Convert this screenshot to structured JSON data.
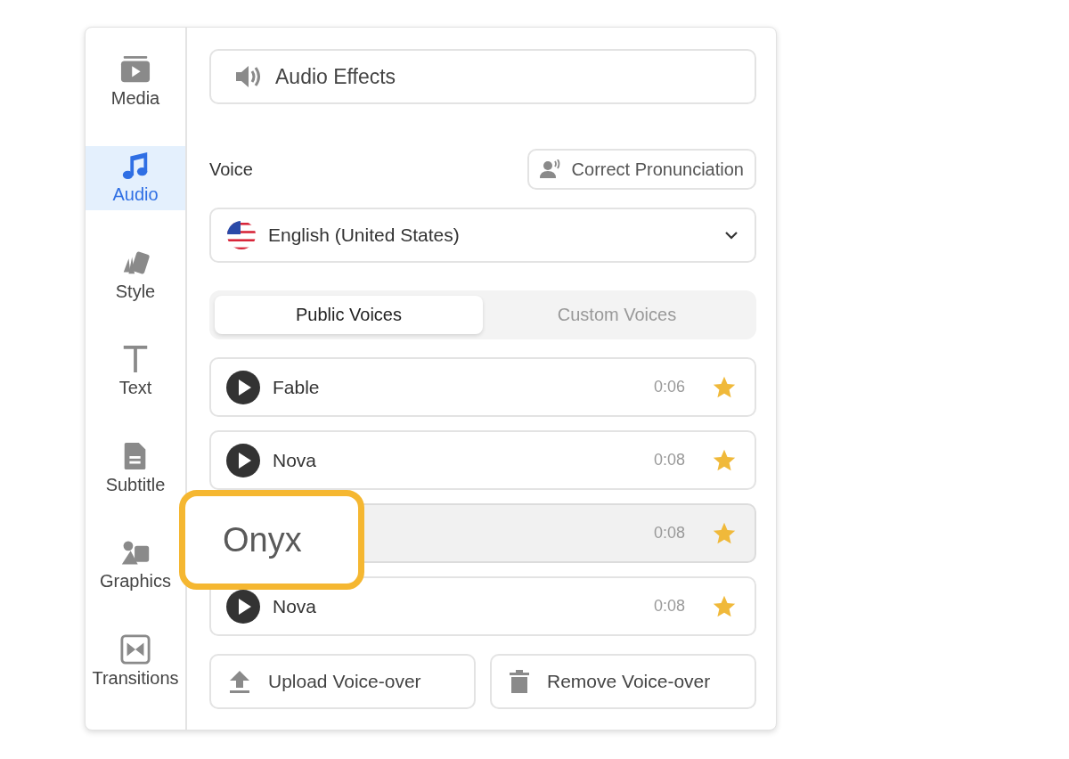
{
  "sidebar": {
    "items": [
      {
        "label": "Media",
        "selected": false
      },
      {
        "label": "Audio",
        "selected": true
      },
      {
        "label": "Style",
        "selected": false
      },
      {
        "label": "Text",
        "selected": false
      },
      {
        "label": "Subtitle",
        "selected": false
      },
      {
        "label": "Graphics",
        "selected": false
      },
      {
        "label": "Transitions",
        "selected": false
      }
    ]
  },
  "audio_effects": {
    "label": "Audio Effects"
  },
  "voice": {
    "label": "Voice",
    "pronunciation_button": "Correct Pronunciation"
  },
  "language": {
    "value": "English (United States)"
  },
  "tabs": [
    {
      "label": "Public Voices",
      "selected": true
    },
    {
      "label": "Custom Voices",
      "selected": false
    }
  ],
  "voices": [
    {
      "name": "Fable",
      "duration": "0:06",
      "starred": true,
      "selected": false
    },
    {
      "name": "Nova",
      "duration": "0:08",
      "starred": true,
      "selected": false
    },
    {
      "duration": "0:08",
      "starred": true,
      "selected": true
    },
    {
      "name": "Nova",
      "duration": "0:08",
      "starred": true,
      "selected": false
    }
  ],
  "callout": {
    "text": "Onyx"
  },
  "buttons": [
    {
      "label": "Upload Voice-over",
      "kind": "upload"
    },
    {
      "label": "Remove Voice-over",
      "kind": "remove"
    }
  ]
}
